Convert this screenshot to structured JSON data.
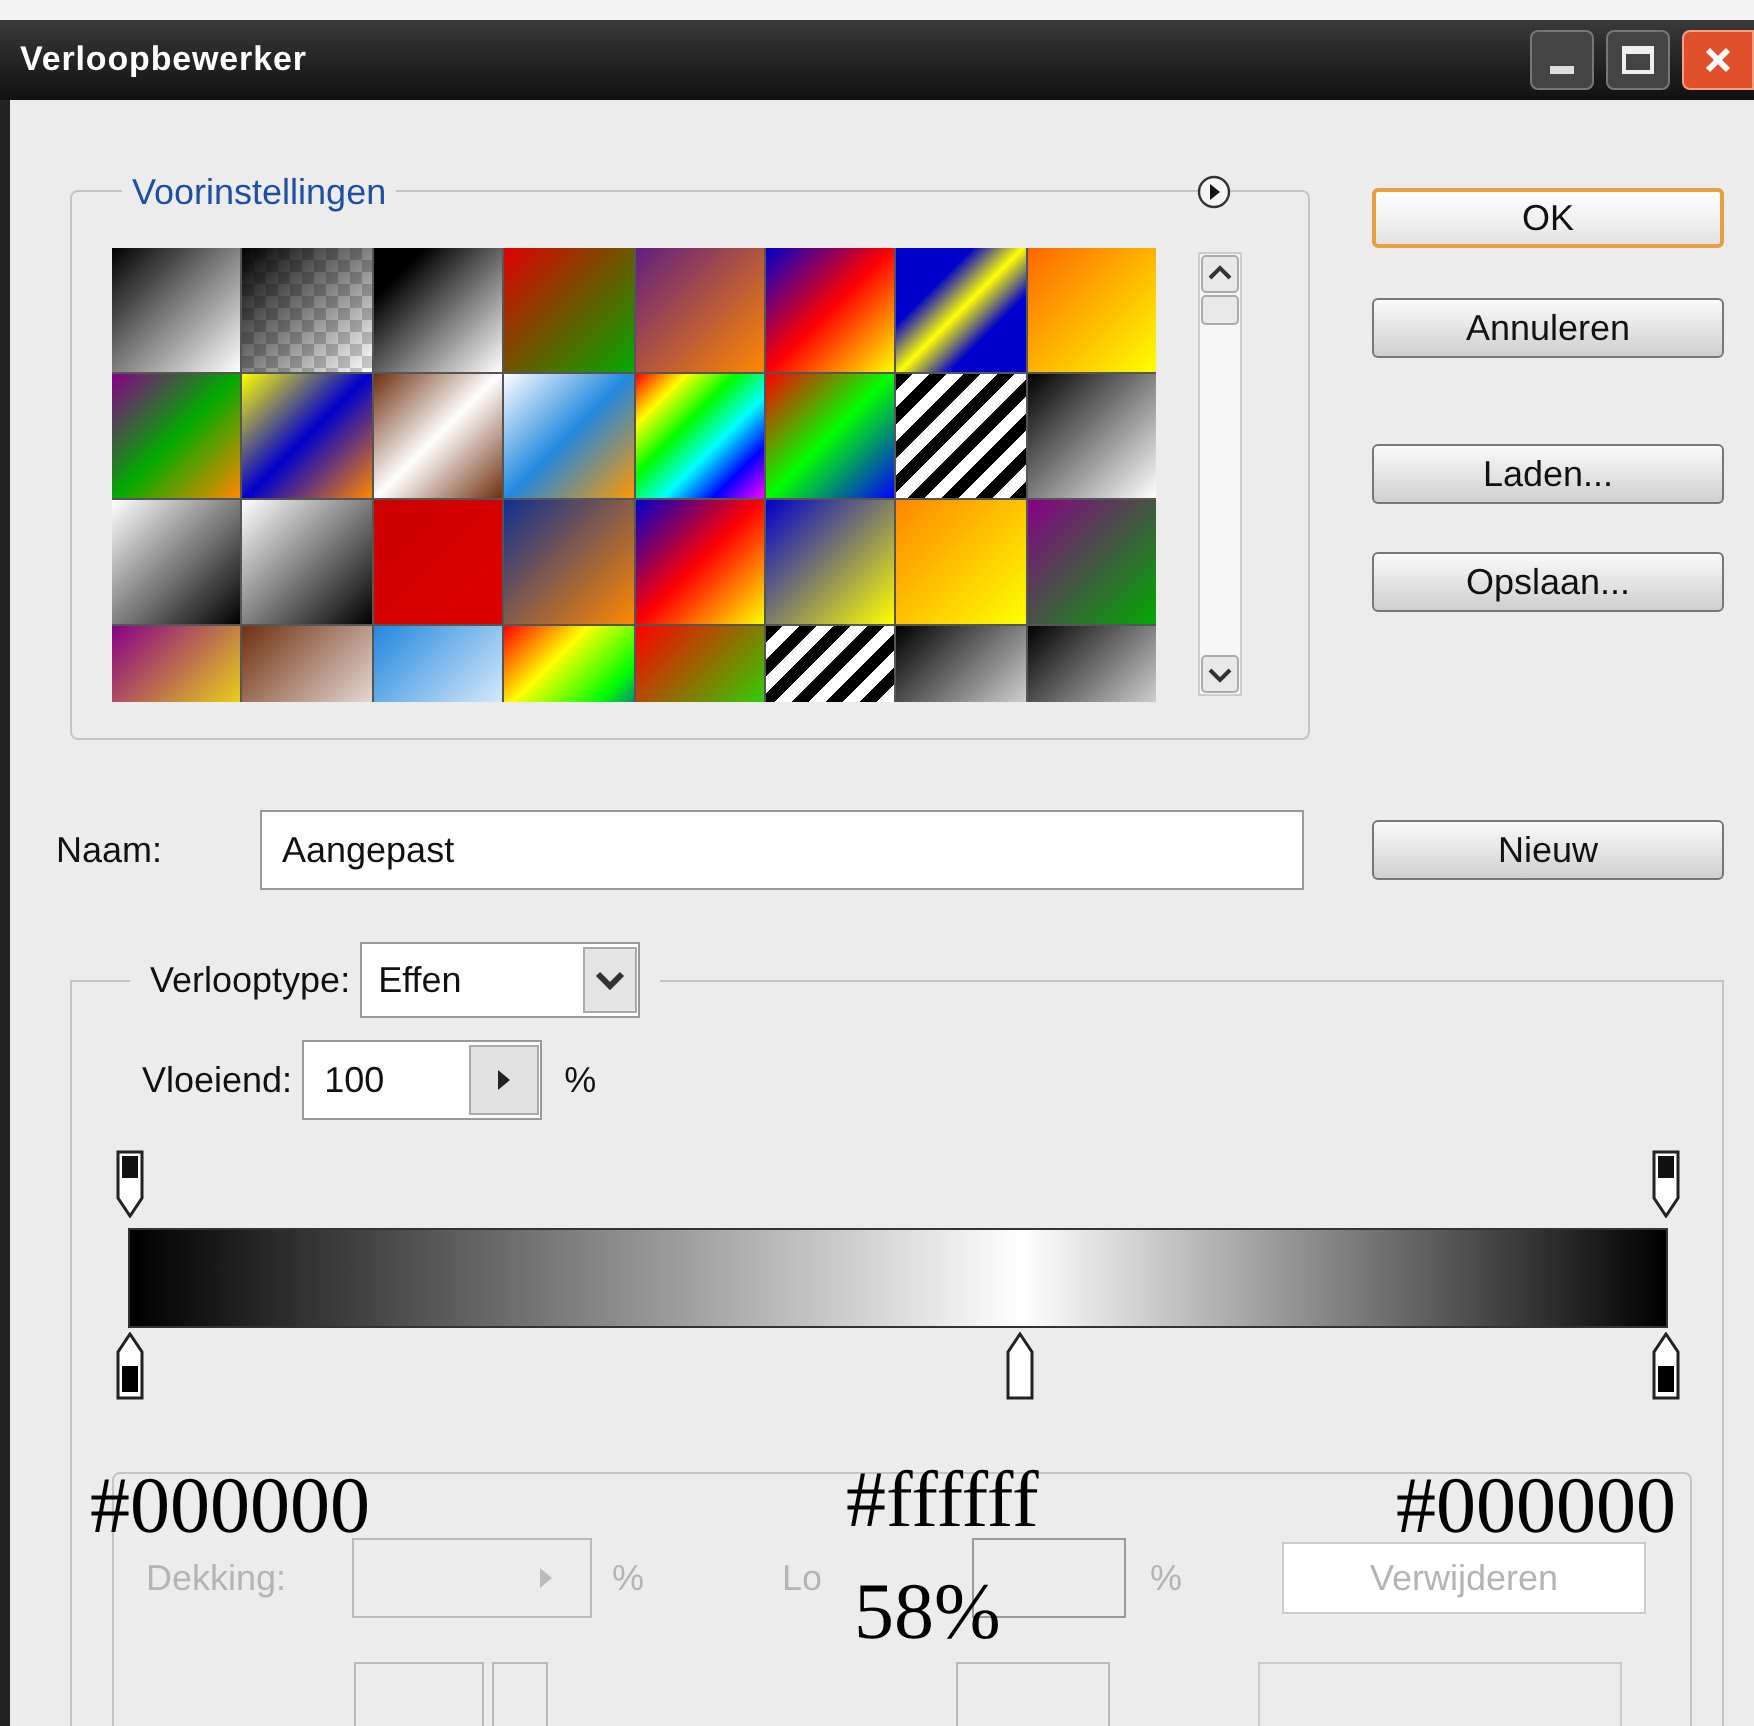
{
  "window": {
    "title": "Verloopbewerker"
  },
  "presets": {
    "title": "Voorinstellingen"
  },
  "buttons": [
    {
      "label": "OK",
      "default": true
    },
    {
      "label": "Annuleren",
      "default": false
    },
    {
      "label": "Laden...",
      "default": false
    },
    {
      "label": "Opslaan...",
      "default": false
    }
  ],
  "name_field": {
    "label": "Naam:",
    "value": "Aangepast"
  },
  "new_button": {
    "label": "Nieuw"
  },
  "gradient": {
    "type_label": "Verlooptype:",
    "type_value": "Effen",
    "smoothness_label": "Vloeiend:",
    "smoothness_value": "100",
    "smoothness_unit": "%",
    "opacity_stops": [
      {
        "level": 0
      },
      {
        "level": 1
      }
    ],
    "color_stops": [
      {
        "level": 0,
        "color": "#000000"
      },
      {
        "level": 0.58,
        "color": "#ffffff"
      },
      {
        "level": 1,
        "color": "#000000"
      }
    ]
  },
  "stops": {
    "disabled": true,
    "opacity_label": "Dekking:",
    "opacity_unit": "%",
    "location_label": "Lo",
    "location_unit": "%",
    "delete_button": "Verwijderen"
  },
  "annotations": [
    {
      "text": "#000000"
    },
    {
      "text": "#ffffff"
    },
    {
      "text": "#000000"
    },
    {
      "text": "58%"
    }
  ]
}
